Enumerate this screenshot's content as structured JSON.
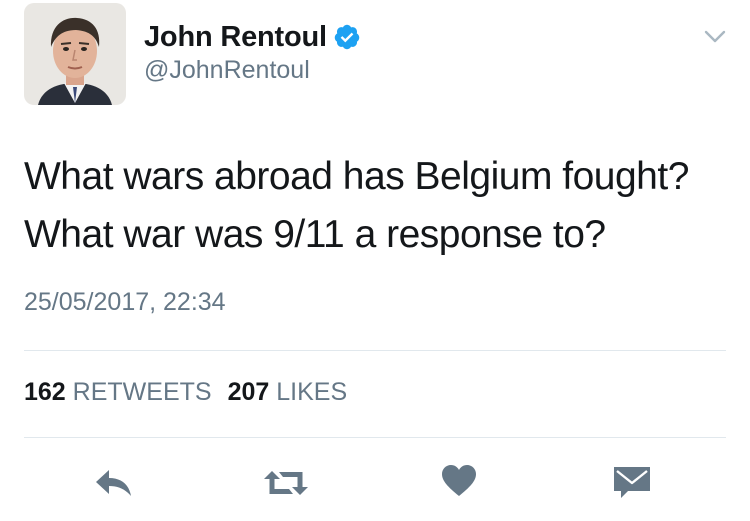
{
  "user": {
    "display_name": "John Rentoul",
    "handle": "@JohnRentoul",
    "verified": true,
    "avatar": "profile-photo"
  },
  "tweet": {
    "text_line_1": "What wars abroad has Belgium fought?",
    "text_line_2": "What war was 9/11 a response to?",
    "timestamp": "25/05/2017, 22:34"
  },
  "stats": {
    "retweets_count": "162",
    "retweets_label": "RETWEETS",
    "likes_count": "207",
    "likes_label": "LIKES"
  },
  "actions": {
    "reply_icon": "reply-icon",
    "retweet_icon": "retweet-icon",
    "like_icon": "heart-icon",
    "dm_icon": "envelope-icon"
  },
  "colors": {
    "text": "#14171a",
    "secondary": "#657786",
    "verified": "#1da1f2",
    "divider": "#e1e8ed",
    "icon": "#657786"
  }
}
